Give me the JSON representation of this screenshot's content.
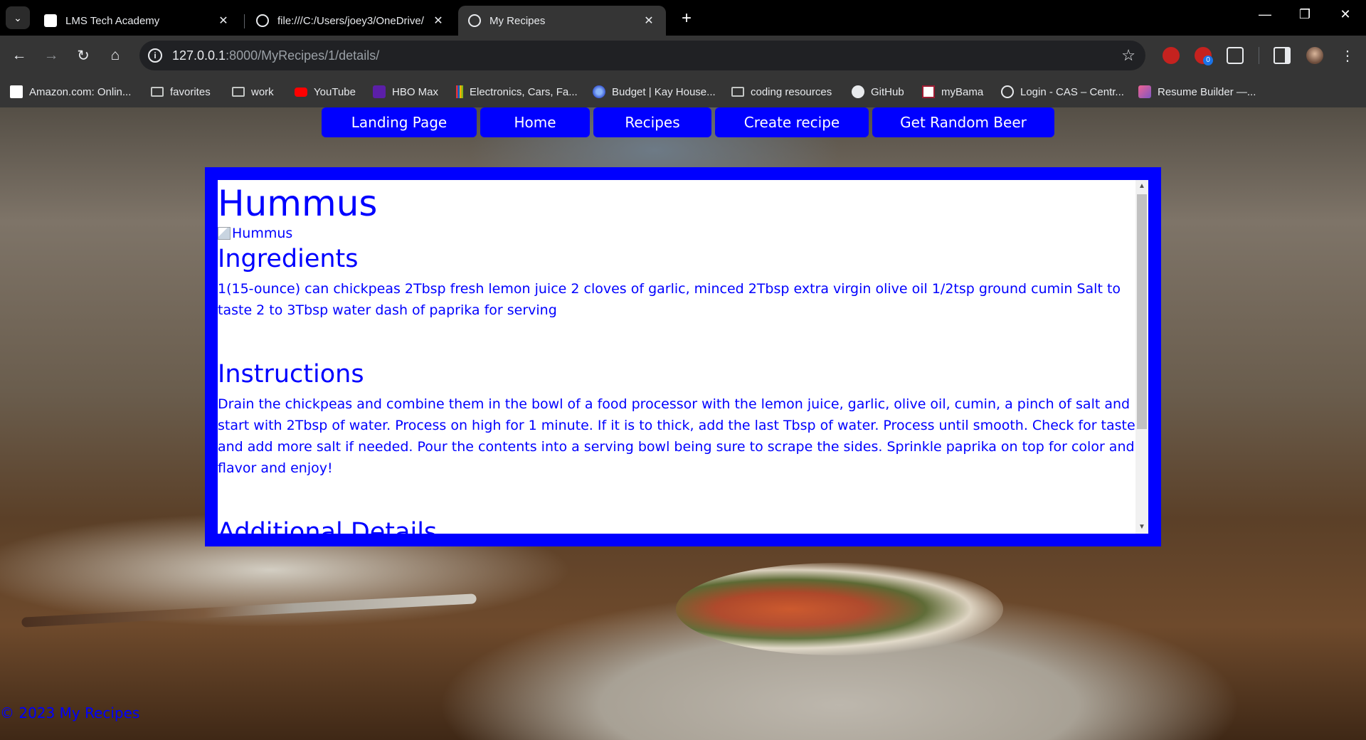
{
  "browser": {
    "tabs": [
      {
        "title": "LMS Tech Academy",
        "favicon": "lms-icon"
      },
      {
        "title": "file:///C:/Users/joey3/OneDrive/",
        "favicon": "globe-icon"
      },
      {
        "title": "My Recipes",
        "favicon": "globe-icon"
      }
    ],
    "url_host": "127.0.0.1",
    "url_path": ":8000/MyRecipes/1/details/",
    "extension_badge": "0",
    "bookmarks": [
      {
        "label": "Amazon.com: Onlin...",
        "icon": "amazon-icon"
      },
      {
        "label": "favorites",
        "icon": "folder-icon"
      },
      {
        "label": "work",
        "icon": "folder-icon"
      },
      {
        "label": "YouTube",
        "icon": "youtube-icon"
      },
      {
        "label": "HBO Max",
        "icon": "hbomax-icon"
      },
      {
        "label": "Electronics, Cars, Fa...",
        "icon": "ebay-icon"
      },
      {
        "label": "Budget | Kay House...",
        "icon": "budget-icon"
      },
      {
        "label": "coding resources",
        "icon": "folder-icon"
      },
      {
        "label": "GitHub",
        "icon": "github-icon"
      },
      {
        "label": "myBama",
        "icon": "mybama-icon"
      },
      {
        "label": "Login - CAS – Centr...",
        "icon": "cas-icon"
      },
      {
        "label": "Resume Builder —...",
        "icon": "resume-icon"
      }
    ]
  },
  "nav": {
    "landing": "Landing Page",
    "home": "Home",
    "recipes": "Recipes",
    "create": "Create recipe",
    "beer": "Get Random Beer"
  },
  "recipe": {
    "title": "Hummus",
    "image_alt": "Hummus",
    "ingredients_heading": "Ingredients",
    "ingredients": "1(15-ounce) can chickpeas 2Tbsp fresh lemon juice 2 cloves of garlic, minced 2Tbsp extra virgin olive oil 1/2tsp ground cumin Salt to taste 2 to 3Tbsp water dash of paprika for serving",
    "instructions_heading": "Instructions",
    "instructions": "Drain the chickpeas and combine them in the bowl of a food processor with the lemon juice, garlic, olive oil, cumin, a pinch of salt and start with 2Tbsp of water. Process on high for 1 minute. If it is to thick, add the last Tbsp of water. Process until smooth. Check for taste and add more salt if needed. Pour the contents into a serving bowl being sure to scrape the sides. Sprinkle paprika on top for color and flavor and enjoy!",
    "additional_heading": "Additional Details"
  },
  "footer": "© 2023 My Recipes",
  "colors": {
    "accent": "#0000ff",
    "chrome": "#353535"
  }
}
